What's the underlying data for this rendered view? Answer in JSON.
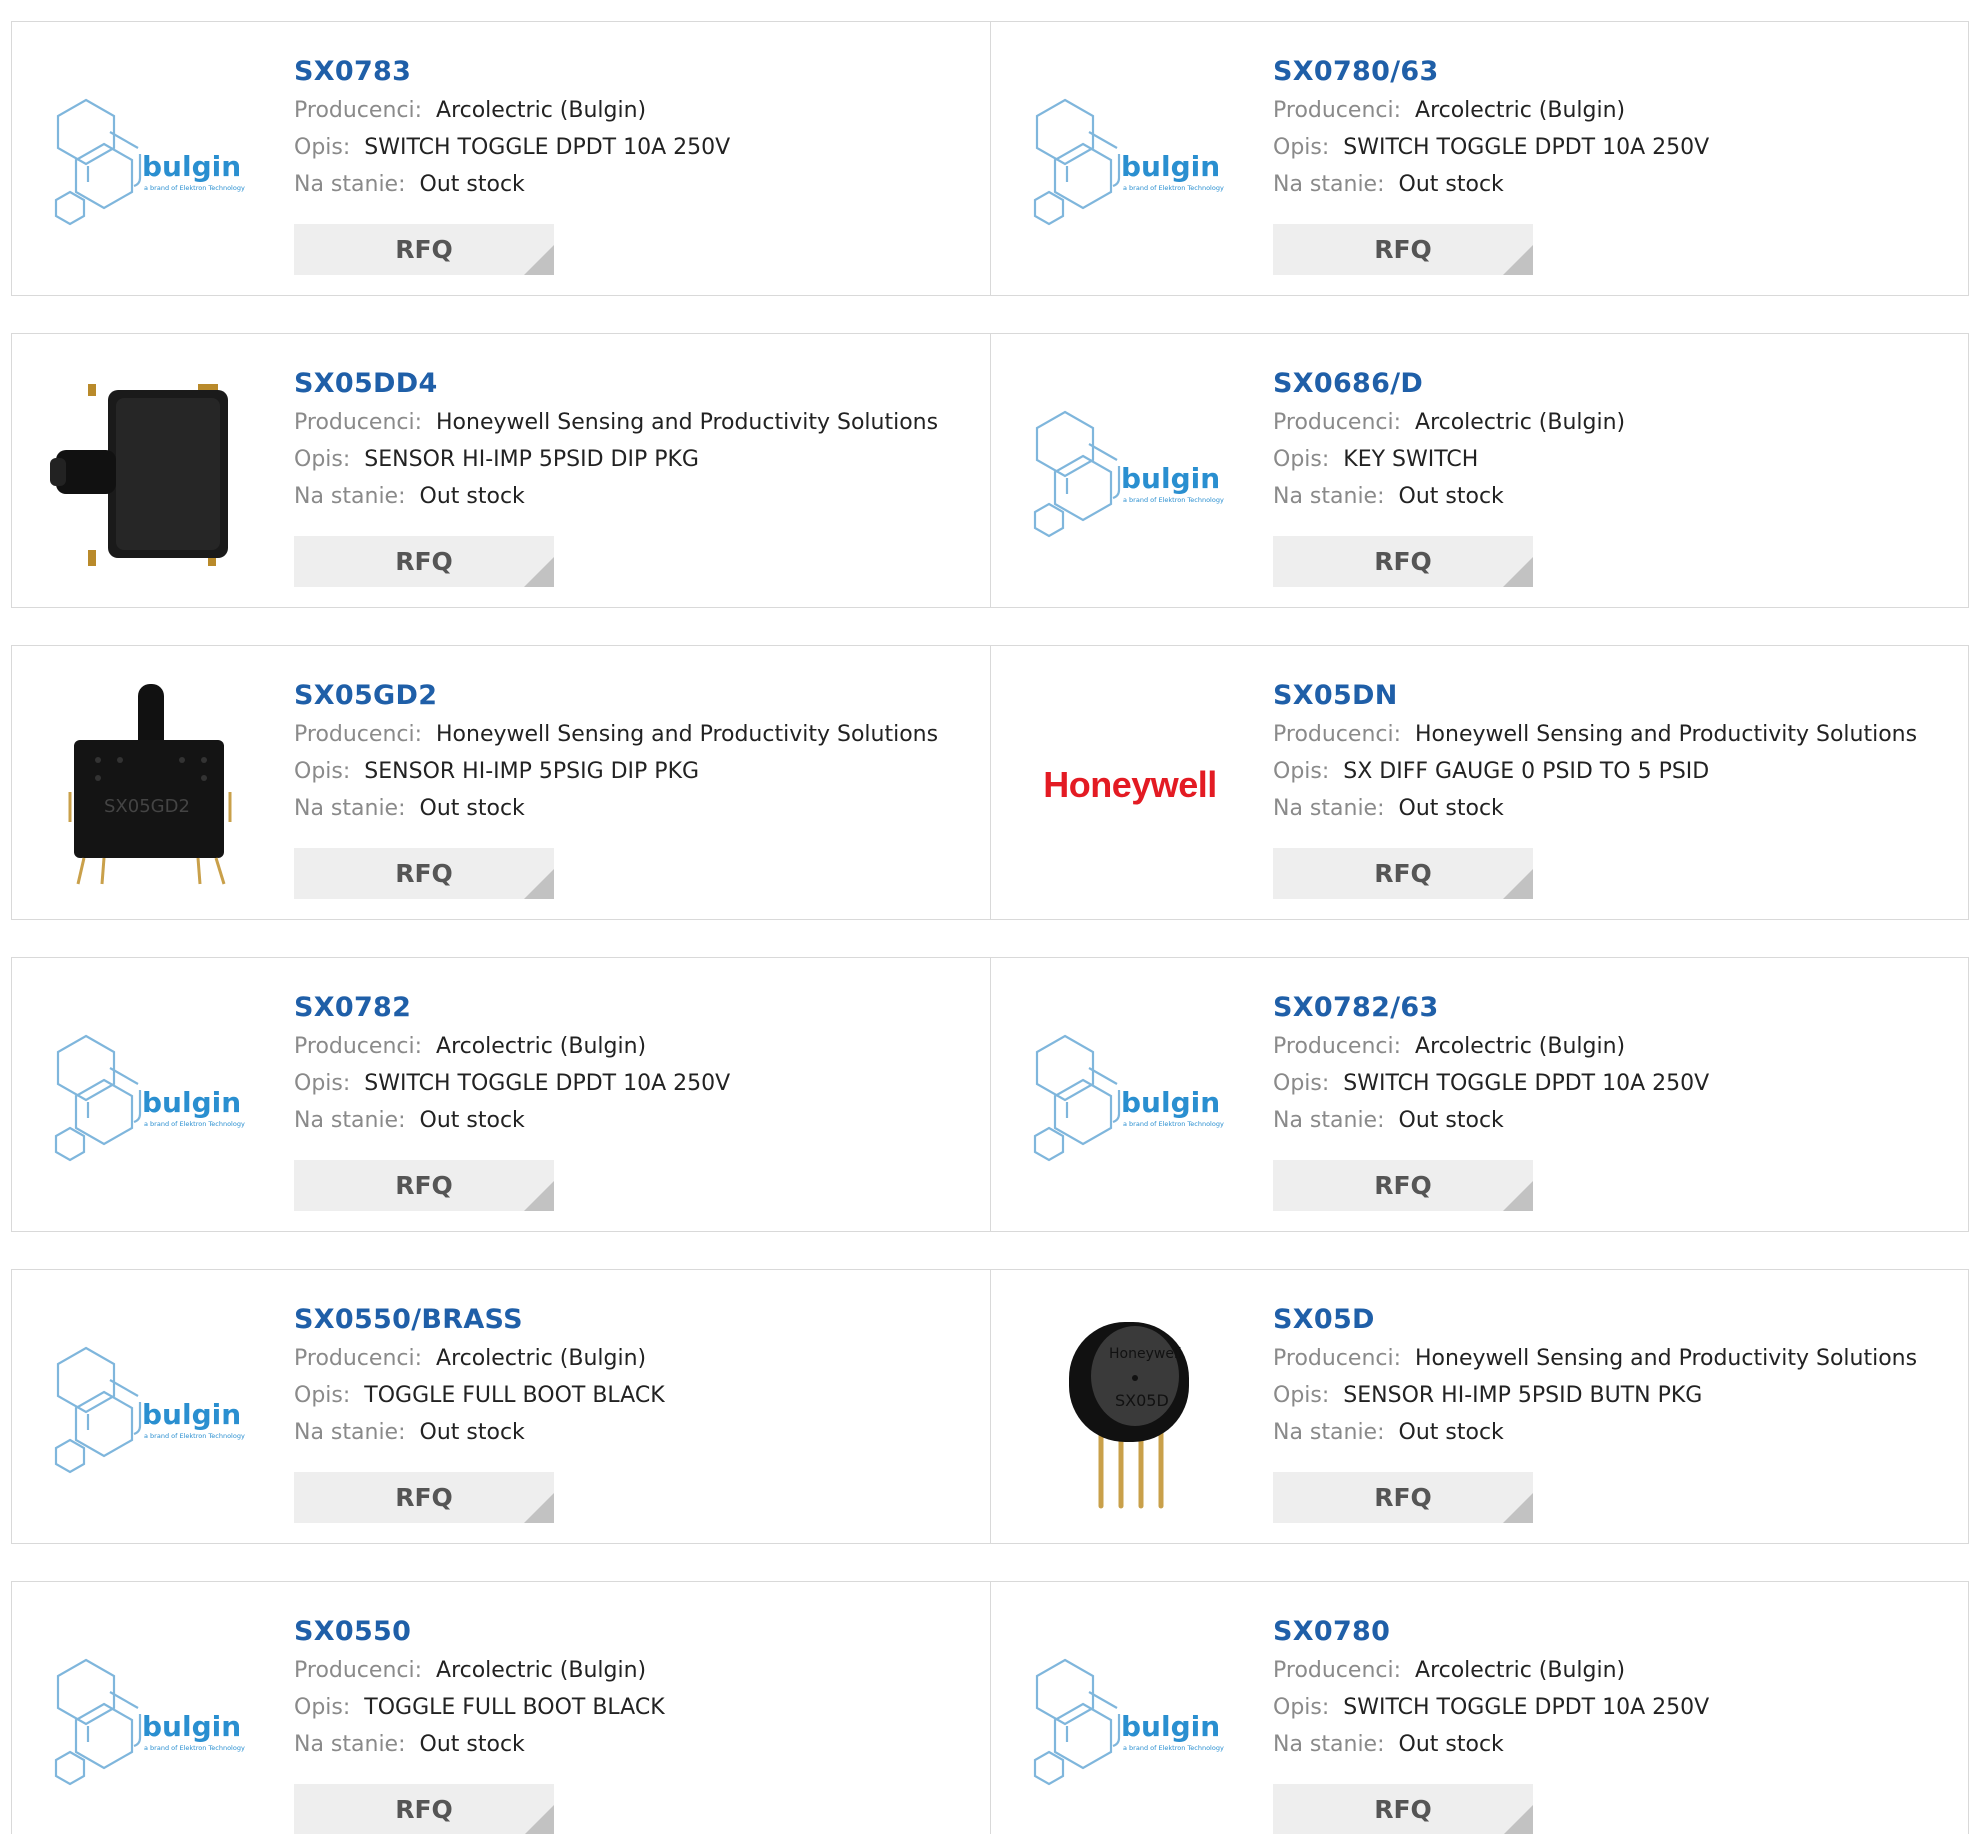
{
  "labels": {
    "manufacturer": "Producenci:",
    "description": "Opis:",
    "stock": "Na stanie:",
    "rfq": "RFQ"
  },
  "brand_logos": {
    "bulgin": {
      "name": "bulgin",
      "tagline": "a brand of Elektron Technology",
      "color": "#2a8fd0"
    },
    "honeywell": {
      "name": "Honeywell",
      "color": "#e31b23"
    }
  },
  "products": [
    {
      "part": "SX0783",
      "manufacturer": "Arcolectric (Bulgin)",
      "description": "SWITCH TOGGLE DPDT 10A 250V",
      "stock": "Out stock",
      "image": "bulgin"
    },
    {
      "part": "SX0780/63",
      "manufacturer": "Arcolectric (Bulgin)",
      "description": "SWITCH TOGGLE DPDT 10A 250V",
      "stock": "Out stock",
      "image": "bulgin"
    },
    {
      "part": "SX05DD4",
      "manufacturer": "Honeywell Sensing and Productivity Solutions",
      "description": "SENSOR HI-IMP 5PSID DIP PKG",
      "stock": "Out stock",
      "image": "sensor-dual-port"
    },
    {
      "part": "SX0686/D",
      "manufacturer": "Arcolectric (Bulgin)",
      "description": "KEY SWITCH",
      "stock": "Out stock",
      "image": "bulgin"
    },
    {
      "part": "SX05GD2",
      "manufacturer": "Honeywell Sensing and Productivity Solutions",
      "description": "SENSOR HI-IMP 5PSIG DIP PKG",
      "stock": "Out stock",
      "image": "sensor-gauge"
    },
    {
      "part": "SX05DN",
      "manufacturer": "Honeywell Sensing and Productivity Solutions",
      "description": "SX DIFF GAUGE 0 PSID TO 5 PSID",
      "stock": "Out stock",
      "image": "honeywell"
    },
    {
      "part": "SX0782",
      "manufacturer": "Arcolectric (Bulgin)",
      "description": "SWITCH TOGGLE DPDT 10A 250V",
      "stock": "Out stock",
      "image": "bulgin"
    },
    {
      "part": "SX0782/63",
      "manufacturer": "Arcolectric (Bulgin)",
      "description": "SWITCH TOGGLE DPDT 10A 250V",
      "stock": "Out stock",
      "image": "bulgin"
    },
    {
      "part": "SX0550/BRASS",
      "manufacturer": "Arcolectric (Bulgin)",
      "description": "TOGGLE FULL BOOT BLACK",
      "stock": "Out stock",
      "image": "bulgin"
    },
    {
      "part": "SX05D",
      "manufacturer": "Honeywell Sensing and Productivity Solutions",
      "description": "SENSOR HI-IMP 5PSID BUTN PKG",
      "stock": "Out stock",
      "image": "sensor-button"
    },
    {
      "part": "SX0550",
      "manufacturer": "Arcolectric (Bulgin)",
      "description": "TOGGLE FULL BOOT BLACK",
      "stock": "Out stock",
      "image": "bulgin"
    },
    {
      "part": "SX0780",
      "manufacturer": "Arcolectric (Bulgin)",
      "description": "SWITCH TOGGLE DPDT 10A 250V",
      "stock": "Out stock",
      "image": "bulgin"
    }
  ]
}
